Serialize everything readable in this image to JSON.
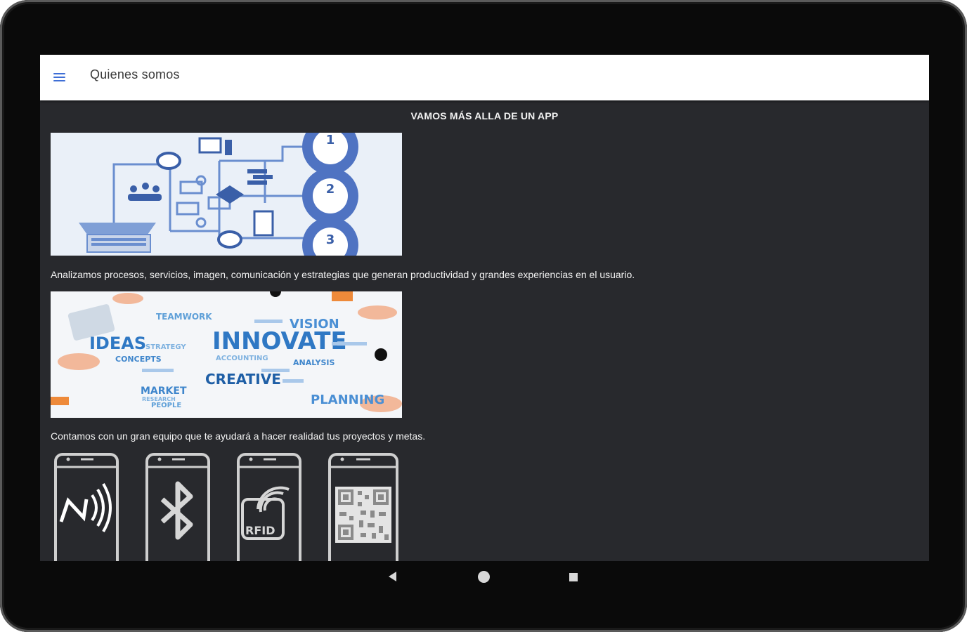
{
  "appbar": {
    "menu_icon": "hamburger-menu-icon",
    "title": "Quienes somos"
  },
  "content": {
    "headline": "VAMOS MÁS ALLA DE UN APP",
    "paragraph_1": "Analizamos procesos, servicios, imagen, comunicación y estrategias que generan productividad y grandes experiencias en el usuario.",
    "paragraph_2": "Contamos con un gran equipo que te ayudará a hacer realidad tus proyectos y metas.",
    "image_2_words": {
      "innovate": "INNOVATE",
      "ideas": "IDEAS",
      "creative": "CREATIVE",
      "teamwork": "TEAMWORK",
      "vision": "VISION",
      "strategy": "STRATEGY",
      "concepts": "CONCEPTS",
      "market": "MARKET",
      "planning": "PLANNING",
      "analysis": "ANALYSIS",
      "accounting": "ACCOUNTING",
      "people": "PEOPLE",
      "research": "RESEARCH"
    },
    "image_1_steps": [
      "1",
      "2",
      "3"
    ],
    "phones": [
      {
        "icon": "nfc-icon"
      },
      {
        "icon": "bluetooth-icon"
      },
      {
        "icon": "rfid-icon",
        "label": "RFID"
      },
      {
        "icon": "qr-code-icon"
      }
    ]
  },
  "system_nav": {
    "back": "back-icon",
    "home": "home-icon",
    "recents": "recents-icon"
  },
  "colors": {
    "background": "#28292d",
    "appbar": "#ffffff",
    "accent": "#3f6fd6",
    "text": "#f2f2f2"
  }
}
